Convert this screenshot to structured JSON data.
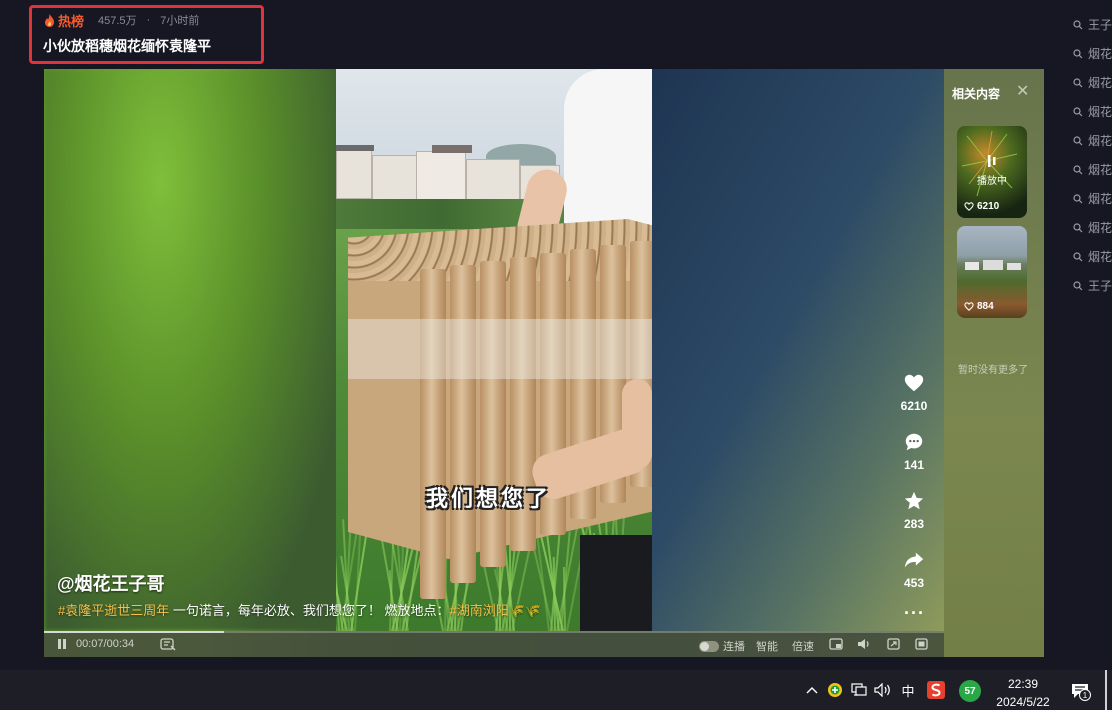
{
  "header": {
    "hot_label": "热榜",
    "views": "457.5万",
    "separator": "·",
    "time_ago": "7小时前",
    "title": "小伙放稻穗烟花缅怀袁隆平"
  },
  "search_sidebar": {
    "items": [
      "王子",
      "烟花",
      "烟花",
      "烟花",
      "烟花",
      "烟花",
      "烟花",
      "烟花",
      "烟花",
      "王子"
    ]
  },
  "video": {
    "subtitle": "我们想您了",
    "author": "@烟花王子哥",
    "desc_tag1": "#袁隆平逝世三周年",
    "desc_text": " 一句诺言，每年必放、我们想您了！ 燃放地点：",
    "desc_tag2": "#湖南浏阳",
    "desc_emoji": "🌾🌾"
  },
  "actions": {
    "likes": "6210",
    "comments": "141",
    "favorites": "283",
    "shares": "453",
    "more": "···"
  },
  "controls": {
    "time": "00:07/00:34",
    "progress": 0.2,
    "autoplay_label": "连播",
    "smart_label": "智能",
    "speed_label": "倍速"
  },
  "related": {
    "title": "相关内容",
    "close": "✕",
    "cards": [
      {
        "status": "播放中",
        "likes": "6210"
      },
      {
        "likes": "884"
      }
    ],
    "no_more": "暂时没有更多了"
  },
  "taskbar": {
    "ime": "中",
    "badge": "57",
    "time": "22:39",
    "date": "2024/5/22",
    "notif_count": "1"
  },
  "colors": {
    "accent_red": "#e0333c",
    "hot_orange": "#f35a2e",
    "tag_yellow": "#f5c14a"
  }
}
